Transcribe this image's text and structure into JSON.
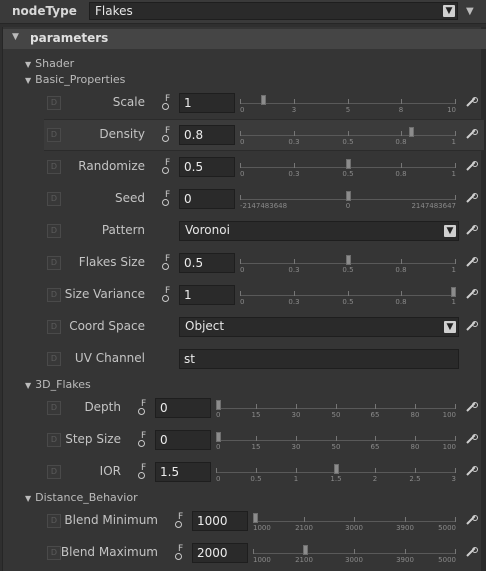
{
  "header": {
    "label": "nodeType",
    "value": "Flakes"
  },
  "group": {
    "title": "parameters"
  },
  "sections": {
    "shader": "Shader",
    "basic": "Basic_Properties",
    "flakes3d": "3D_Flakes",
    "distance": "Distance_Behavior"
  },
  "d_glyph": "D",
  "key_glyph": "F",
  "params": {
    "scale": {
      "label": "Scale",
      "value": "1",
      "ticks": [
        "0",
        "3",
        "5",
        "8",
        "10"
      ],
      "level": 0.1
    },
    "density": {
      "label": "Density",
      "value": "0.8",
      "ticks": [
        "0",
        "0.3",
        "0.5",
        "0.8",
        "1"
      ],
      "level": 0.8
    },
    "randomize": {
      "label": "Randomize",
      "value": "0.5",
      "ticks": [
        "0",
        "0.3",
        "0.5",
        "0.8",
        "1"
      ],
      "level": 0.5
    },
    "seed": {
      "label": "Seed",
      "value": "0",
      "ticks": [
        "-2147483648",
        "0",
        "2147483647"
      ],
      "level": 0.5
    },
    "pattern": {
      "label": "Pattern",
      "value": "Voronoi"
    },
    "flakes_size": {
      "label": "Flakes Size",
      "value": "0.5",
      "ticks": [
        "0",
        "0.3",
        "0.5",
        "0.8",
        "1"
      ],
      "level": 0.5
    },
    "size_variance": {
      "label": "Size Variance",
      "value": "1",
      "ticks": [
        "0",
        "0.3",
        "0.5",
        "0.8",
        "1"
      ],
      "level": 1.0
    },
    "coord_space": {
      "label": "Coord Space",
      "value": "Object"
    },
    "uv_channel": {
      "label": "UV Channel",
      "value": "st"
    },
    "depth": {
      "label": "Depth",
      "value": "0",
      "ticks": [
        "0",
        "15",
        "30",
        "50",
        "65",
        "80",
        "100"
      ],
      "level": 0.0
    },
    "step_size": {
      "label": "Step Size",
      "value": "0",
      "ticks": [
        "0",
        "15",
        "30",
        "50",
        "65",
        "80",
        "100"
      ],
      "level": 0.0
    },
    "ior": {
      "label": "IOR",
      "value": "1.5",
      "ticks": [
        "0",
        "0.5",
        "1",
        "1.5",
        "2",
        "2.5",
        "3"
      ],
      "level": 0.5
    },
    "blend_min": {
      "label": "Blend Minimum",
      "value": "1000",
      "ticks": [
        "1000",
        "2100",
        "3000",
        "3900",
        "5000"
      ],
      "level": 0.0
    },
    "blend_max": {
      "label": "Blend Maximum",
      "value": "2000",
      "ticks": [
        "1000",
        "2100",
        "3000",
        "3900",
        "5000"
      ],
      "level": 0.25
    }
  }
}
